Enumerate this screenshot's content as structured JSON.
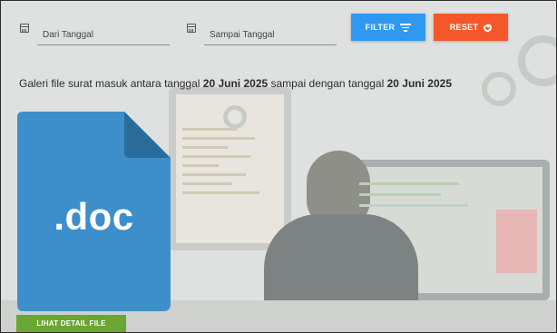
{
  "filters": {
    "from_label": "Dari Tanggal",
    "to_label": "Sampai Tanggal",
    "filter_label": "FILTER",
    "reset_label": "RESET"
  },
  "caption": {
    "prefix": "Galeri file surat masuk antara tanggal ",
    "start_date": "20 Juni 2025",
    "middle": " sampai dengan tanggal ",
    "end_date": "20 Juni 2025"
  },
  "file_card": {
    "extension": ".doc",
    "detail_button": "LIHAT DETAIL FILE",
    "icon": "doc-file-icon"
  },
  "colors": {
    "filter": "#2f98f0",
    "reset": "#f4582a",
    "doc": "#3d8fcb",
    "detail": "#6aa633"
  }
}
